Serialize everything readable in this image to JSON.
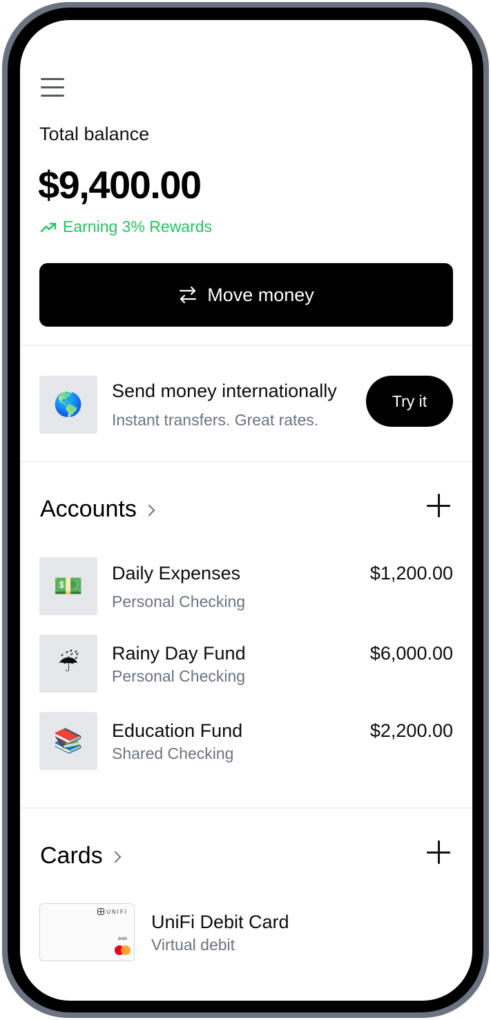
{
  "header": {
    "menu_icon": "hamburger-menu-icon"
  },
  "balance": {
    "label": "Total balance",
    "amount": "$9,400.00",
    "rewards_text": "Earning 3% Rewards",
    "rewards_color": "#22c55e"
  },
  "move_money": {
    "label": "Move money",
    "icon": "swap-arrows-icon"
  },
  "international": {
    "icon": "globe-emoji",
    "title": "Send money internationally",
    "subtitle": "Instant transfers. Great rates.",
    "cta": "Try it"
  },
  "accounts": {
    "title": "Accounts",
    "items": [
      {
        "icon": "money-emoji",
        "emoji": "💵",
        "name": "Daily Expenses",
        "type": "Personal Checking",
        "amount": "$1,200.00"
      },
      {
        "icon": "umbrella-rain-emoji",
        "emoji": "☔",
        "name": "Rainy Day Fund",
        "type": "Personal Checking",
        "amount": "$6,000.00"
      },
      {
        "icon": "books-emoji",
        "emoji": "📚",
        "name": "Education Fund",
        "type": "Shared Checking",
        "amount": "$2,200.00"
      }
    ]
  },
  "cards": {
    "title": "Cards",
    "items": [
      {
        "name": "UniFi Debit Card",
        "type": "Virtual debit",
        "brand": "UNIFI",
        "debit_label": "debit"
      }
    ]
  },
  "colors": {
    "accent": "#000000",
    "secondary_text": "#6b7280",
    "tile_bg": "#e6e7ea"
  }
}
